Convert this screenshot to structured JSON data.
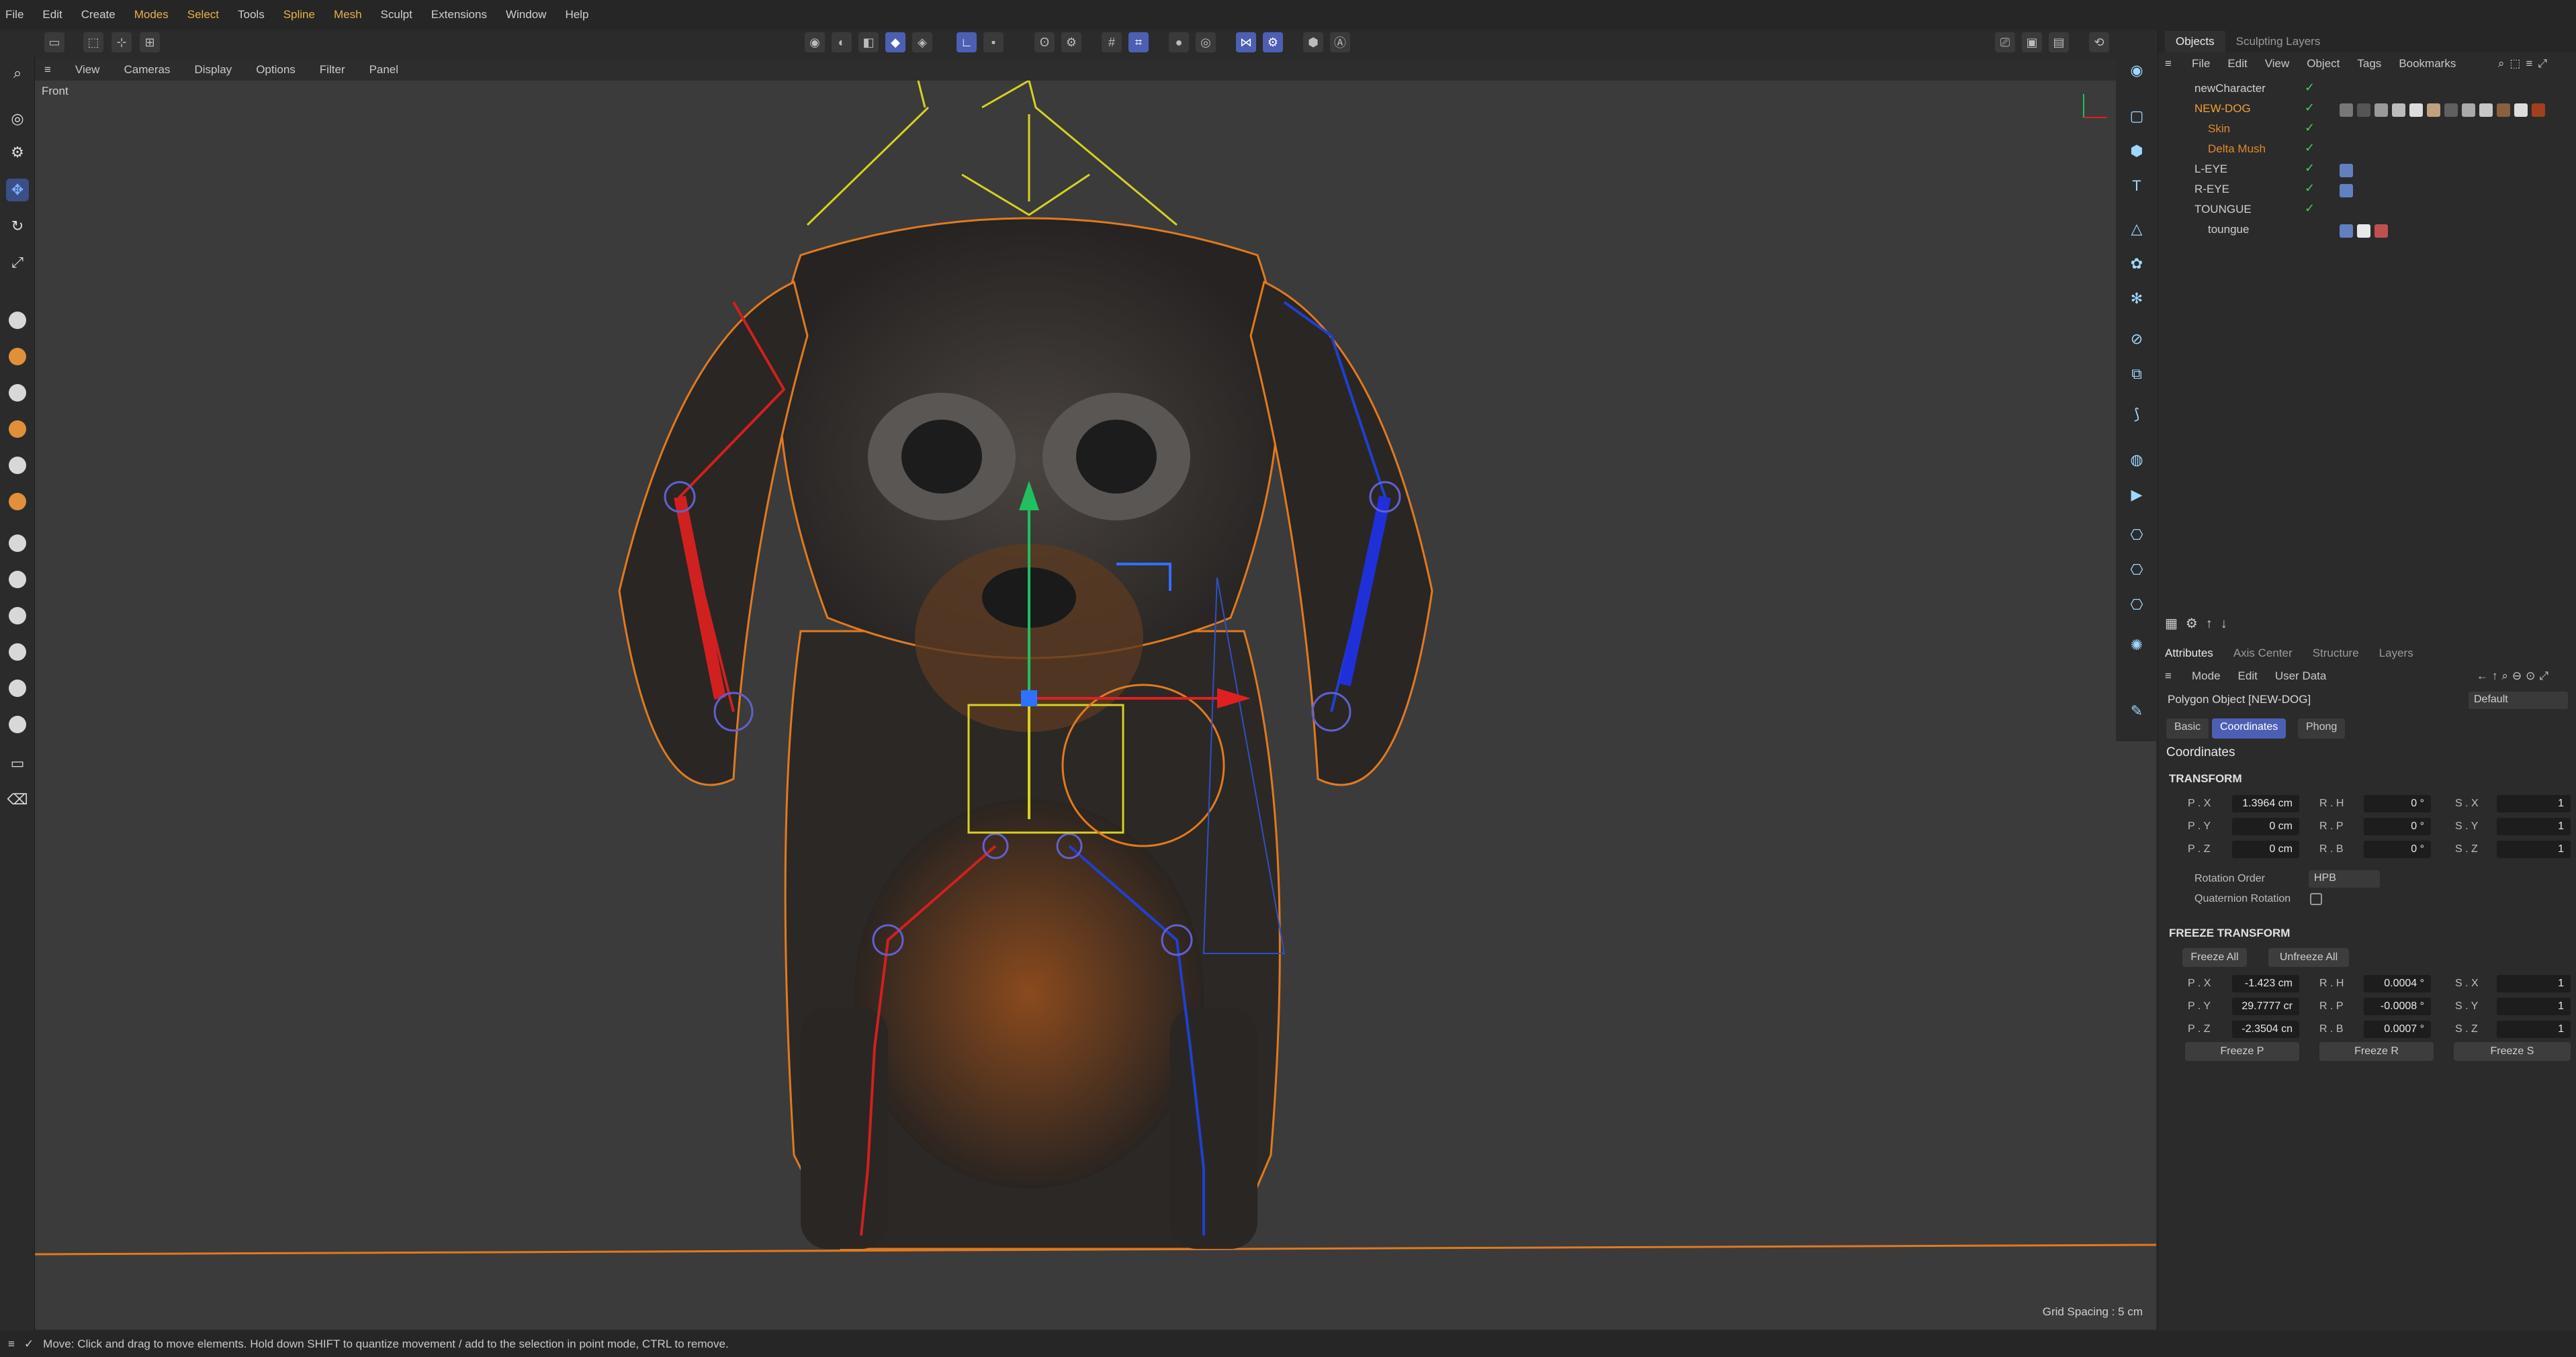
{
  "menubar": {
    "items": [
      "File",
      "Edit",
      "Create",
      "Modes",
      "Select",
      "Tools",
      "Spline",
      "Mesh",
      "Sculpt",
      "Extensions",
      "Window",
      "Help"
    ]
  },
  "viewport": {
    "menu": [
      "View",
      "Cameras",
      "Display",
      "Options",
      "Filter",
      "Panel"
    ],
    "label": "Front",
    "grid_spacing": "Grid Spacing : 5 cm"
  },
  "objects_panel": {
    "tabs": [
      "Objects",
      "Sculpting Layers"
    ],
    "menu": [
      "File",
      "Edit",
      "View",
      "Object",
      "Tags",
      "Bookmarks"
    ],
    "rows": [
      {
        "name": "newCharacter",
        "color": "#cfcfcf"
      },
      {
        "name": "NEW-DOG",
        "color": "#f0a030"
      },
      {
        "name": "Skin",
        "color": "#e08a2a"
      },
      {
        "name": "Delta Mush",
        "color": "#e08a2a"
      },
      {
        "name": "L-EYE",
        "color": "#cfcfcf"
      },
      {
        "name": "R-EYE",
        "color": "#cfcfcf"
      },
      {
        "name": "TOUNGUE",
        "color": "#cfcfcf"
      },
      {
        "name": "toungue",
        "color": "#cfcfcf"
      }
    ]
  },
  "attributes_panel": {
    "tabs": [
      "Attributes",
      "Axis Center",
      "Structure",
      "Layers"
    ],
    "menu": [
      "Mode",
      "Edit",
      "User Data"
    ],
    "object_title": "Polygon Object [NEW-DOG]",
    "preset": "Default",
    "subtabs": [
      "Basic",
      "Coordinates",
      "Phong"
    ],
    "heading": "Coordinates",
    "transform": {
      "title": "TRANSFORM",
      "px": "1.3964 cm",
      "py": "0 cm",
      "pz": "0 cm",
      "rh": "0 °",
      "rp": "0 °",
      "rb": "0 °",
      "sx": "1",
      "sy": "1",
      "sz": "1",
      "rotation_order_label": "Rotation Order",
      "rotation_order_value": "HPB",
      "quaternion_label": "Quaternion Rotation"
    },
    "freeze": {
      "title": "FREEZE TRANSFORM",
      "freeze_all": "Freeze All",
      "unfreeze_all": "Unfreeze All",
      "px": "-1.423 cm",
      "py": "29.7777 cr",
      "pz": "-2.3504 cn",
      "rh": "0.0004 °",
      "rp": "-0.0008 °",
      "rb": "0.0007 °",
      "sx": "1",
      "sy": "1",
      "sz": "1",
      "freeze_p": "Freeze P",
      "freeze_r": "Freeze R",
      "freeze_s": "Freeze S"
    },
    "labels": {
      "px": "P . X",
      "py": "P . Y",
      "pz": "P . Z",
      "rh": "R . H",
      "rp": "R . P",
      "rb": "R . B",
      "sx": "S . X",
      "sy": "S . Y",
      "sz": "S . Z"
    }
  },
  "statusbar": {
    "text": "Move: Click and drag to move elements. Hold down SHIFT to quantize movement / add to the selection in point mode, CTRL to remove."
  }
}
